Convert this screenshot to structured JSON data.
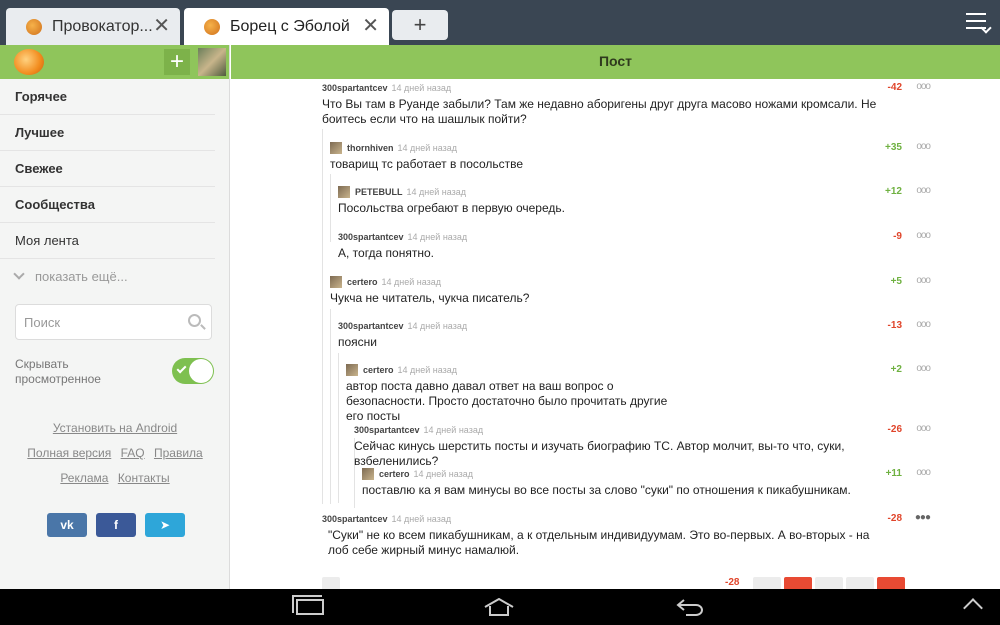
{
  "tabs": [
    {
      "title": "Провокатор...",
      "active": false
    },
    {
      "title": "Борец с Эболой",
      "active": true
    }
  ],
  "new_tab_label": "+",
  "sidebar": {
    "nav": [
      "Горячее",
      "Лучшее",
      "Свежее",
      "Сообщества",
      "Моя лента"
    ],
    "show_more": "показать ещё...",
    "search_placeholder": "Поиск",
    "hide_viewed_label": "Скрывать просмотренное",
    "hide_viewed_on": true,
    "links": {
      "install": "Установить на Android",
      "full_version": "Полная версия",
      "faq": "FAQ",
      "rules": "Правила",
      "ads": "Реклама",
      "contacts": "Контакты"
    },
    "social": {
      "vk": "vk",
      "fb": "f",
      "tg": "➤"
    }
  },
  "content": {
    "title": "Пост",
    "comments": [
      {
        "author": "300spartantcev",
        "time": "14 дней назад",
        "score": "-42",
        "text": "Что Вы там в Руанде забыли? Там же недавно аборигены друг друга масово ножами кромсали. Не боитесь если что на шашлык пойти?"
      },
      {
        "author": "thornhiven",
        "time": "14 дней назад",
        "score": "+35",
        "text": "товарищ тс работает в посольстве"
      },
      {
        "author": "PETEBULL",
        "time": "14 дней назад",
        "score": "+12",
        "text": "Посольства огребают в первую очередь."
      },
      {
        "author": "300spartantcev",
        "time": "14 дней назад",
        "score": "-9",
        "text": "А, тогда понятно."
      },
      {
        "author": "certero",
        "time": "14 дней назад",
        "score": "+5",
        "text": "Чукча не читатель, чукча писатель?"
      },
      {
        "author": "300spartantcev",
        "time": "14 дней назад",
        "score": "-13",
        "text": "поясни"
      },
      {
        "author": "certero",
        "time": "14 дней назад",
        "score": "+2",
        "text": "автор поста давно давал ответ на ваш вопрос о безопасности. Просто достаточно было прочитать другие его посты"
      },
      {
        "author": "300spartantcev",
        "time": "14 дней назад",
        "score": "-26",
        "text": "Сейчас кинусь шерстить посты и изучать биографию ТС. Автор молчит, вы-то что, суки, взбеленились?"
      },
      {
        "author": "certero",
        "time": "14 дней назад",
        "score": "+11",
        "text": "поставлю ка я вам минусы во все посты за слово \"суки\" по отношения к пикабушникам."
      },
      {
        "author": "300spartantcev",
        "time": "14 дней назад",
        "score": "-28",
        "text": "\"Суки\" не ко всем пикабушникам, а к отдельным индивидуумам. Это во-первых. А во-вторых - на лоб себе жирный минус намалюй."
      }
    ],
    "bottom_score": "-28"
  },
  "colors": {
    "accent": "#8fc55b",
    "tabbar": "#3a4653",
    "positive": "#6fb141",
    "negative": "#e0452b"
  }
}
